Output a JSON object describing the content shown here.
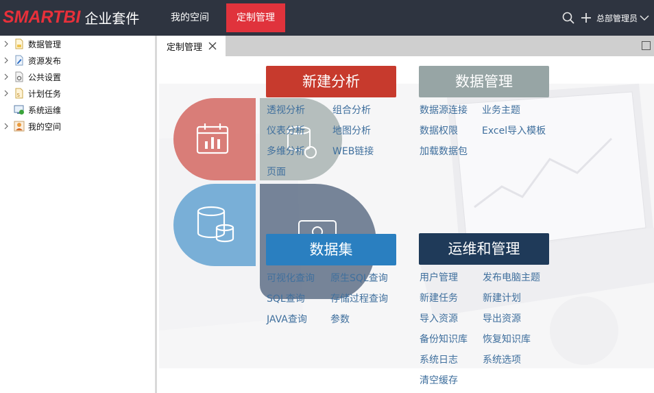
{
  "colors": {
    "topbar_bg": "#2e3440",
    "brand_red": "#e8303a",
    "active_nav": "#e0333c",
    "analysis": "#c73a2d",
    "data_management": "#97a5a5",
    "dataset": "#2a7fc0",
    "ops": "#1f3a59",
    "link": "#3f6f9d"
  },
  "header": {
    "logo_mark": "SMARTBI",
    "logo_suite": "企业套件",
    "nav": [
      "我的空间",
      "定制管理"
    ],
    "active_nav": "定制管理",
    "icons": [
      "search-icon",
      "plus-icon"
    ],
    "user": "总部管理员"
  },
  "sidebar": {
    "items": [
      {
        "label": "数据管理",
        "icon": "data-management-icon",
        "expandable": true
      },
      {
        "label": "资源发布",
        "icon": "resource-publish-icon",
        "expandable": true
      },
      {
        "label": "公共设置",
        "icon": "public-settings-icon",
        "expandable": true
      },
      {
        "label": "计划任务",
        "icon": "scheduled-task-icon",
        "expandable": true
      },
      {
        "label": "系统运维",
        "icon": "system-ops-icon",
        "expandable": false
      },
      {
        "label": "我的空间",
        "icon": "my-space-icon",
        "expandable": true
      }
    ]
  },
  "tabs": [
    {
      "label": "定制管理",
      "closable": true
    }
  ],
  "groups": {
    "analysis": {
      "title": "新建分析",
      "links": [
        "透视分析",
        "组合分析",
        "仪表分析",
        "地图分析",
        "多维分析",
        "WEB链接",
        "页面"
      ]
    },
    "data_management": {
      "title": "数据管理",
      "links": [
        "数据源连接",
        "业务主题",
        "数据权限",
        "Excel导入模板",
        "加载数据包"
      ]
    },
    "dataset": {
      "title": "数据集",
      "links": [
        "可视化查询",
        "原生SQL查询",
        "SQL查询",
        "存储过程查询",
        "JAVA查询",
        "参数"
      ]
    },
    "ops": {
      "title": "运维和管理",
      "links": [
        "用户管理",
        "发布电脑主题",
        "新建任务",
        "新建计划",
        "导入资源",
        "导出资源",
        "备份知识库",
        "恢复知识库",
        "系统日志",
        "系统选项",
        "清空缓存"
      ]
    }
  }
}
